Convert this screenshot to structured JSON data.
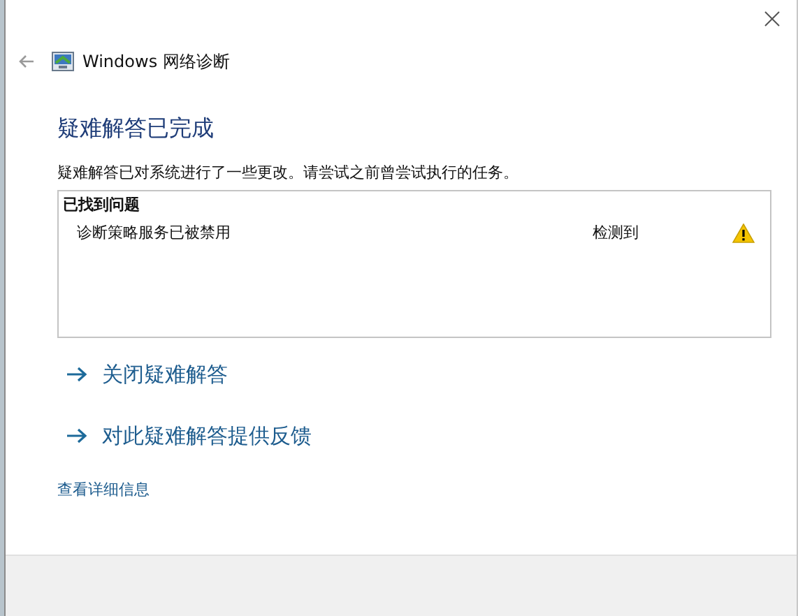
{
  "window": {
    "title": "Windows 网络诊断"
  },
  "heading": "疑难解答已完成",
  "description": "疑难解答已对系统进行了一些更改。请尝试之前曾尝试执行的任务。",
  "problems": {
    "title": "已找到问题",
    "rows": [
      {
        "name": "诊断策略服务已被禁用",
        "status": "检测到",
        "kind": "warning"
      }
    ]
  },
  "actions": [
    {
      "label": "关闭疑难解答"
    },
    {
      "label": "对此疑难解答提供反馈"
    }
  ],
  "details_link": "查看详细信息"
}
